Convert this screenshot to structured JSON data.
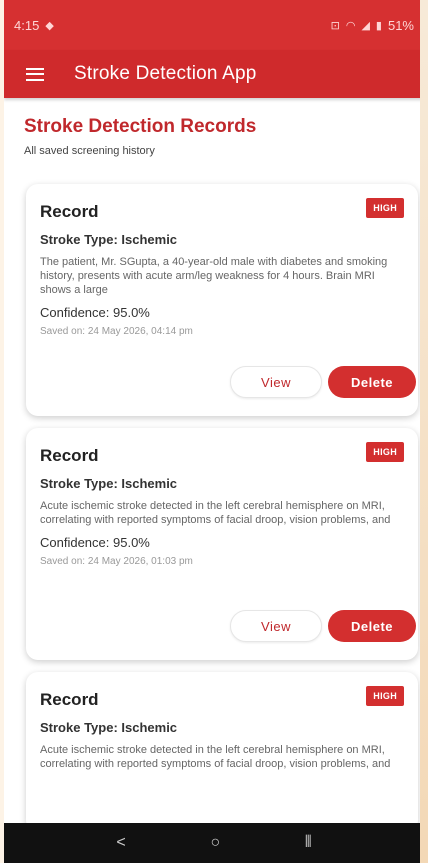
{
  "status_bar": {
    "time": "4:15",
    "battery": "51%",
    "colors": {
      "background": "#d63031"
    }
  },
  "app_bar": {
    "title": "Stroke Detection App"
  },
  "page": {
    "title": "Stroke Detection Records",
    "subtitle": "All saved screening history"
  },
  "records": [
    {
      "title": "Record",
      "badge": "HIGH",
      "stroke_type": "Stroke Type: Ischemic",
      "description": "The patient, Mr. SGupta, a 40-year-old male with diabetes and smoking history, presents with acute arm/leg weakness for 4 hours. Brain MRI shows a large",
      "confidence": "Confidence: 95.0%",
      "saved_on": "Saved on: 24 May 2026, 04:14 pm",
      "view_label": "View",
      "delete_label": "Delete"
    },
    {
      "title": "Record",
      "badge": "HIGH",
      "stroke_type": "Stroke Type: Ischemic",
      "description": "Acute ischemic stroke detected in the left cerebral hemisphere on MRI, correlating with reported symptoms of facial droop, vision problems, and",
      "confidence": "Confidence: 95.0%",
      "saved_on": "Saved on: 24 May 2026, 01:03 pm",
      "view_label": "View",
      "delete_label": "Delete"
    },
    {
      "title": "Record",
      "badge": "HIGH",
      "stroke_type": "Stroke Type: Ischemic",
      "description": "Acute ischemic stroke detected in the left cerebral hemisphere on MRI, correlating with reported symptoms of facial droop, vision problems, and"
    }
  ],
  "nav_bar": {
    "back_icon": "chevron-left-icon",
    "home_icon": "circle-icon",
    "recents_icon": "recents-icon"
  },
  "theme": {
    "primary": "#d32f2f",
    "app_bar": "#cf2a2c",
    "title_red": "#c0282c"
  }
}
